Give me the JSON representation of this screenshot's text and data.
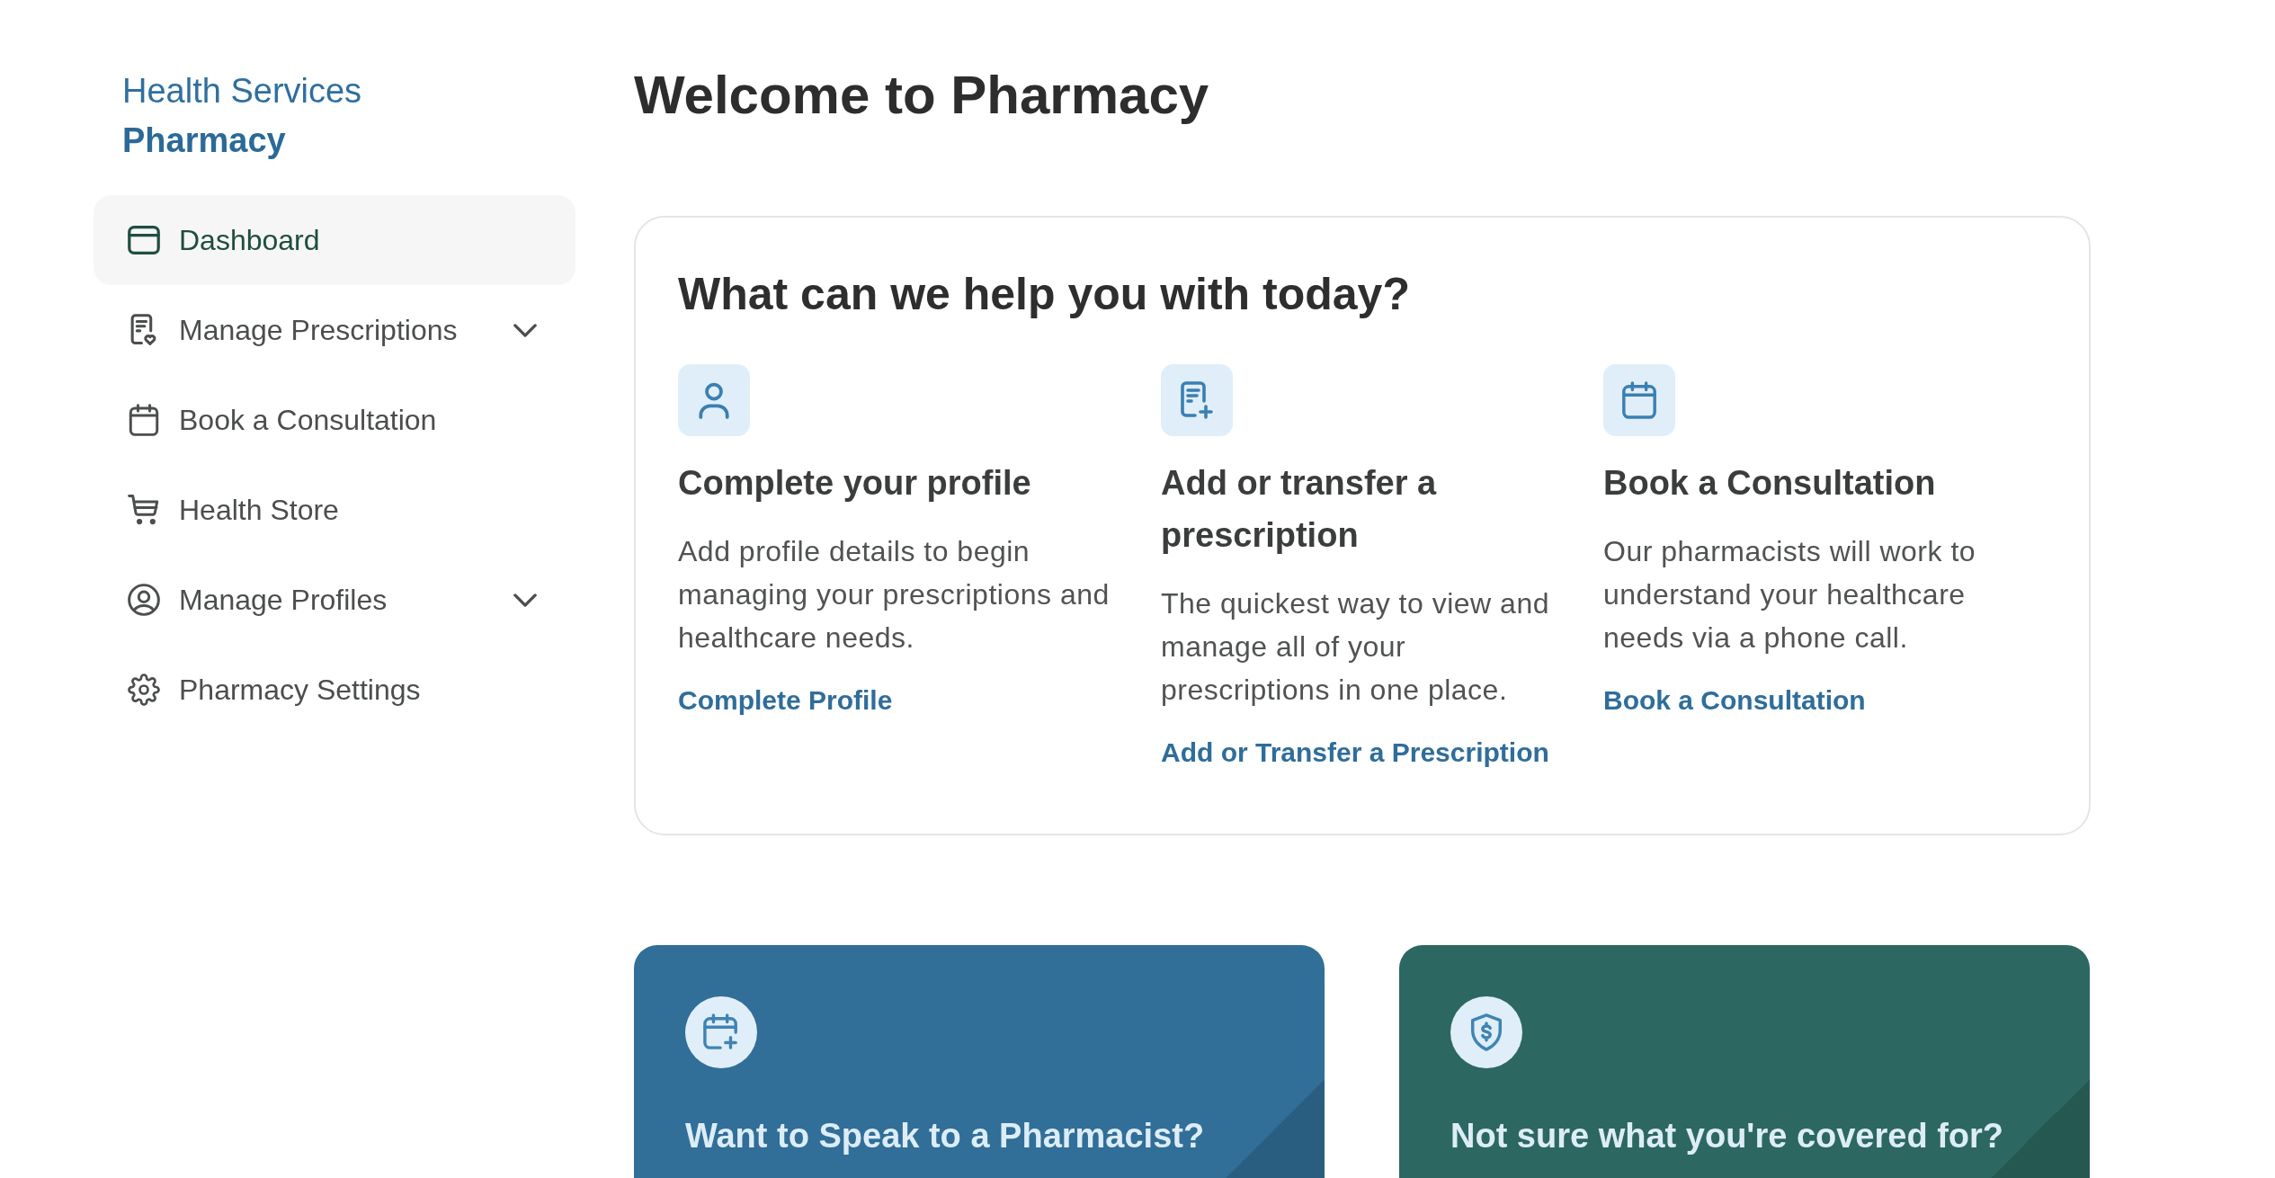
{
  "sidebar": {
    "section": "Health Services",
    "title": "Pharmacy",
    "items": [
      {
        "label": "Dashboard",
        "selected": true,
        "expandable": false
      },
      {
        "label": "Manage Prescriptions",
        "selected": false,
        "expandable": true
      },
      {
        "label": "Book a Consultation",
        "selected": false,
        "expandable": false
      },
      {
        "label": "Health Store",
        "selected": false,
        "expandable": false
      },
      {
        "label": "Manage Profiles",
        "selected": false,
        "expandable": true
      },
      {
        "label": "Pharmacy Settings",
        "selected": false,
        "expandable": false
      }
    ]
  },
  "page_title": "Welcome to Pharmacy",
  "help_panel": {
    "heading": "What can we help you with today?",
    "options": [
      {
        "title": "Complete your profile",
        "description": "Add profile details to begin managing your prescriptions and healthcare needs.",
        "link": "Complete Profile"
      },
      {
        "title": "Add or transfer a prescription",
        "description": "The quickest way to view and manage all of your prescriptions in one place.",
        "link": "Add or Transfer a Prescription"
      },
      {
        "title": "Book a Consultation",
        "description": "Our pharmacists will work to understand your healthcare needs via a phone call.",
        "link": "Book a Consultation"
      }
    ]
  },
  "promo_cards": [
    {
      "title": "Want to Speak to a Pharmacist?",
      "color": "#316e98"
    },
    {
      "title": "Not sure what you're covered for?",
      "color": "#2d6761"
    }
  ]
}
